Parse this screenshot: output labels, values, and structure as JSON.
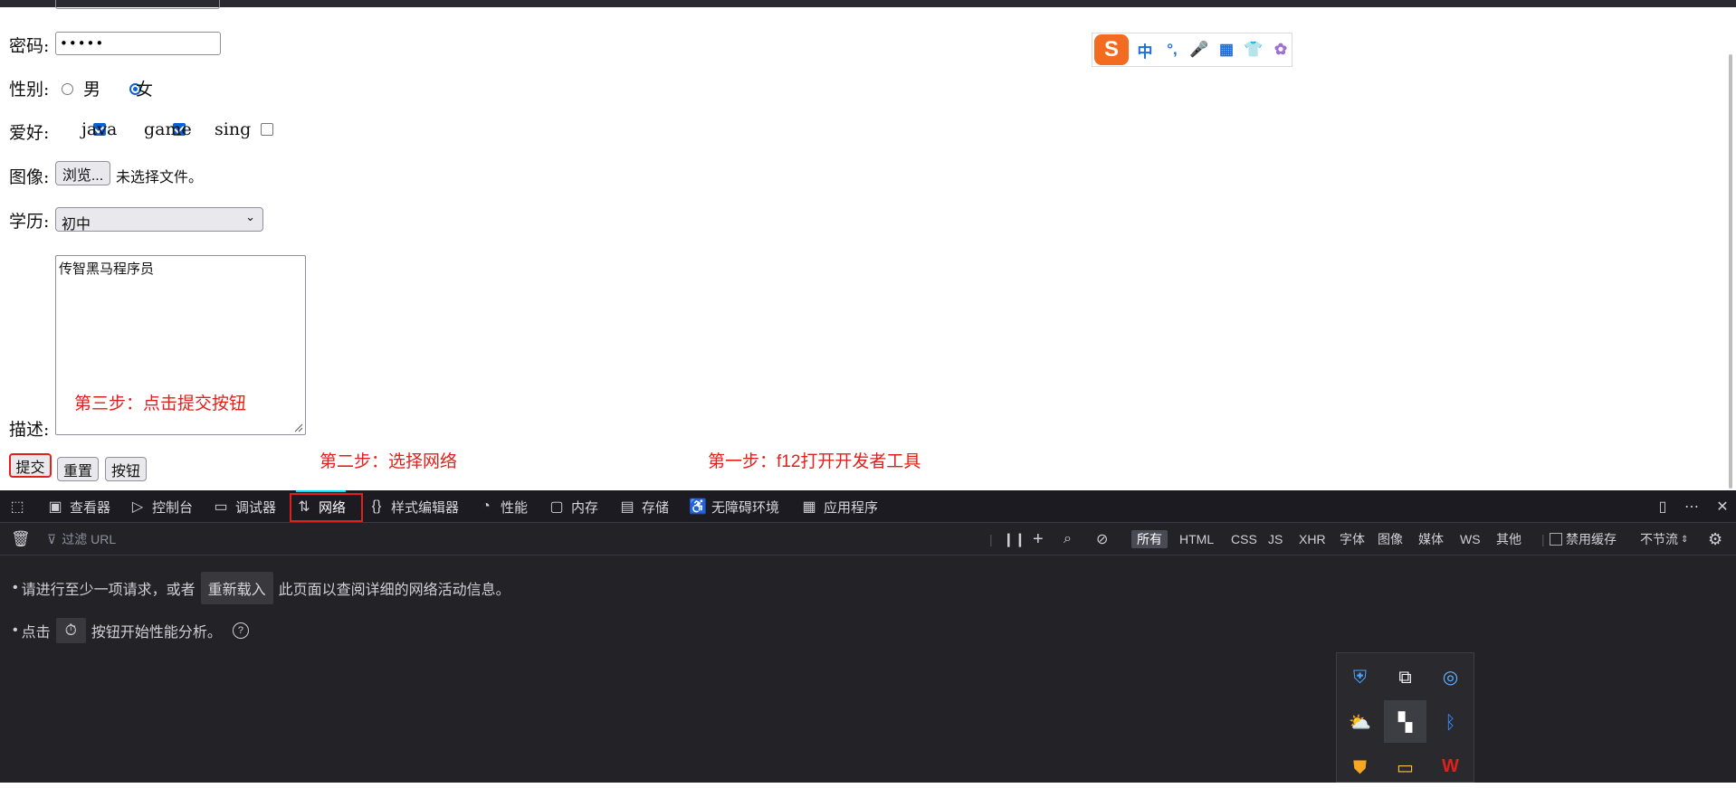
{
  "form": {
    "password_label": "密码:",
    "password_value": "•••••",
    "gender_label": "性别:",
    "gender_male": "男",
    "gender_female": "女",
    "hobby_label": "爱好:",
    "hobby_java": "java",
    "hobby_game": "game",
    "hobby_sing": "sing",
    "image_label": "图像:",
    "browse_button": "浏览...",
    "no_file": "未选择文件。",
    "edu_label": "学历:",
    "edu_selected": "初中",
    "desc_label": "描述:",
    "desc_value": "传智黑马程序员",
    "submit_button": "提交",
    "reset_button": "重置",
    "plain_button": "按钮"
  },
  "annotations": {
    "step3": "第三步：点击提交按钮",
    "step2": "第二步：选择网络",
    "step1": "第一步：f12打开开发者工具"
  },
  "ime": {
    "mode": "中",
    "punct": "°,"
  },
  "devtools": {
    "tabs": [
      {
        "label": "查看器",
        "icon": "inspector-icon"
      },
      {
        "label": "控制台",
        "icon": "console-icon"
      },
      {
        "label": "调试器",
        "icon": "debugger-icon"
      },
      {
        "label": "网络",
        "icon": "network-icon"
      },
      {
        "label": "样式编辑器",
        "icon": "style-editor-icon"
      },
      {
        "label": "性能",
        "icon": "performance-icon"
      },
      {
        "label": "内存",
        "icon": "memory-icon"
      },
      {
        "label": "存储",
        "icon": "storage-icon"
      },
      {
        "label": "无障碍环境",
        "icon": "accessibility-icon"
      },
      {
        "label": "应用程序",
        "icon": "application-icon"
      }
    ],
    "filter_placeholder": "过滤 URL",
    "filters": [
      "所有",
      "HTML",
      "CSS",
      "JS",
      "XHR",
      "字体",
      "图像",
      "媒体",
      "WS",
      "其他"
    ],
    "disable_cache": "禁用缓存",
    "throttle": "不节流",
    "msg1_pre": "请进行至少一项请求，或者",
    "msg1_button": "重新载入",
    "msg1_post": "此页面以查阅详细的网络活动信息。",
    "msg2_pre": "点击",
    "msg2_post": "按钮开始性能分析。"
  }
}
